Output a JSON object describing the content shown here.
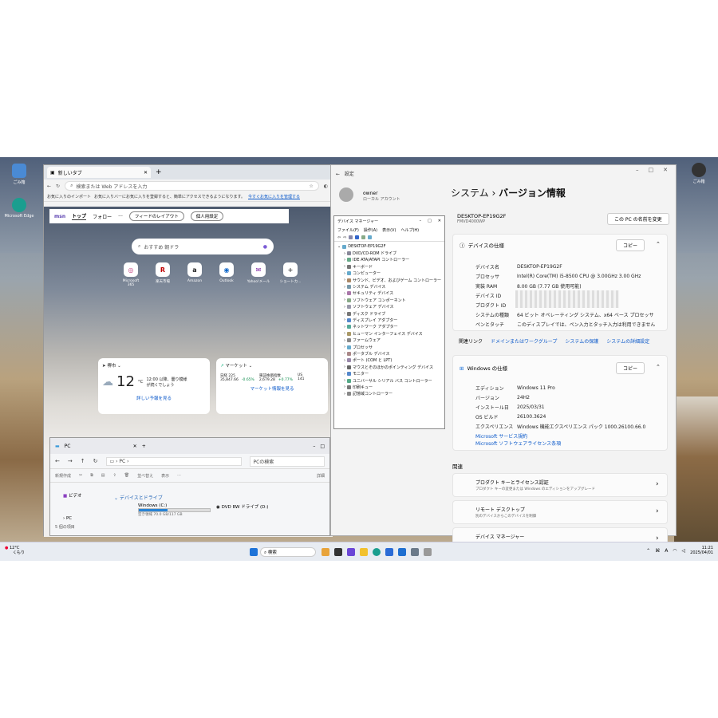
{
  "desktop": {
    "icons": [
      {
        "label": "ごみ箱",
        "color": "#4a8ad4"
      },
      {
        "label": "Microsoft Edge",
        "color": "#1a9e8f"
      }
    ],
    "right_icon": "ごみ箱"
  },
  "edge": {
    "tab_label": "新しいタブ",
    "addr_placeholder": "検索または Web アドレスを入力",
    "fav_import": "お気に入りのインポート",
    "fav_text": "お気に入りバーにお気に入りを登録すると、簡単にアクセスできるようになります。",
    "fav_link": "今すぐお気に入りを管理する",
    "search_text": "おすすめ 朝ドラ",
    "quicklinks": [
      {
        "label": "Microsoft 365",
        "glyph": "◎",
        "color": "#c03b7c"
      },
      {
        "label": "楽天市場",
        "glyph": "R",
        "color": "#bf0000"
      },
      {
        "label": "Amazon",
        "glyph": "a",
        "color": "#222"
      },
      {
        "label": "Outlook",
        "glyph": "◉",
        "color": "#0a64c8"
      },
      {
        "label": "Yahoo!メール",
        "glyph": "✉",
        "color": "#7b1fa2"
      },
      {
        "label": "ショートカ...",
        "glyph": "+",
        "color": "#444"
      }
    ],
    "weather": {
      "location": "堺市",
      "temp": "12",
      "unit": "°C",
      "note": "12:00 以降、曇り模様が続くでしょう",
      "link": "詳しい予報を見る"
    },
    "market": {
      "title": "マーケット",
      "items": [
        {
          "name": "日経 225",
          "value": "35,847.66",
          "change": "-0.65%"
        },
        {
          "name": "東証株価指数",
          "value": "2,679.28",
          "change": "+0.77%"
        },
        {
          "name": "US",
          "value": "141",
          "change": ""
        }
      ],
      "link": "マーケット情報を見る"
    },
    "msn": {
      "brand": "msn",
      "tabs": [
        "トップ",
        "フォロー"
      ],
      "more": "···",
      "layout": "フィードのレイアウト",
      "personal": "個人用設定"
    }
  },
  "explorer": {
    "title": "PC",
    "path": "PC",
    "search": "PCの検索",
    "cmds": [
      "新規作成",
      "並べ替え",
      "表示",
      "···",
      "詳細"
    ],
    "quick": "ビデオ",
    "group": "デバイスとドライブ",
    "drive_c": "Windows (C:)",
    "drive_c_info": "空き領域 70.0 GB/117 GB",
    "drive_c_used": 0.4,
    "drive_d": "DVD RW ドライブ (D:)",
    "tree_pc": "PC",
    "status": "5 個の項目"
  },
  "settings": {
    "app": "設定",
    "user": "owner",
    "user_sub": "ローカル アカウント",
    "breadcrumb_a": "システム",
    "breadcrumb_b": "バージョン情報",
    "pc_name": "DESKTOP-EP19G2F",
    "pc_model": "FMVD4000WP",
    "rename": "この PC の名前を変更",
    "spec_title": "デバイスの仕様",
    "copy": "コピー",
    "spec": [
      {
        "k": "デバイス名",
        "v": "DESKTOP-EP19G2F"
      },
      {
        "k": "プロセッサ",
        "v": "Intel(R) Core(TM) i5-8500 CPU @ 3.00GHz   3.00 GHz"
      },
      {
        "k": "実装 RAM",
        "v": "8.00 GB (7.77 GB 使用可能)"
      },
      {
        "k": "デバイス ID",
        "v": ""
      },
      {
        "k": "プロダクト ID",
        "v": ""
      },
      {
        "k": "システムの種類",
        "v": "64 ビット オペレーティング システム、x64 ベース プロセッサ"
      },
      {
        "k": "ペンとタッチ",
        "v": "このディスプレイでは、ペン入力とタッチ入力は利用できません"
      }
    ],
    "related_label": "関連リンク",
    "related": [
      "ドメインまたはワークグループ",
      "システムの保護",
      "システムの詳細設定"
    ],
    "win_title": "Windows の仕様",
    "win": [
      {
        "k": "エディション",
        "v": "Windows 11 Pro"
      },
      {
        "k": "バージョン",
        "v": "24H2"
      },
      {
        "k": "インストール日",
        "v": "2025/03/31"
      },
      {
        "k": "OS ビルド",
        "v": "26100.3624"
      },
      {
        "k": "エクスペリエンス",
        "v": "Windows 機能エクスペリエンス パック 1000.26100.66.0"
      }
    ],
    "links": [
      "Microsoft サービス規約",
      "Microsoft ソフトウェアライセンス条項"
    ],
    "kanren": "関連",
    "items": [
      {
        "t": "プロダクト キーとライセンス認証",
        "s": "プロダクト キーの変更または Windows のエディションをアップグレード"
      },
      {
        "t": "リモート デスクトップ",
        "s": "別のデバイスからこのデバイスを制御"
      },
      {
        "t": "デバイス マネージャー",
        "s": ""
      }
    ]
  },
  "devmgr": {
    "title": "デバイス マネージャー",
    "menu": [
      "ファイル(F)",
      "操作(A)",
      "表示(V)",
      "ヘルプ(H)"
    ],
    "root": "DESKTOP-EP19G2F",
    "nodes": [
      "DVD/CD-ROM ドライブ",
      "IDE ATA/ATAPI コントローラー",
      "キーボード",
      "コンピューター",
      "サウンド、ビデオ、およびゲーム コントローラー",
      "システム デバイス",
      "セキュリティ デバイス",
      "ソフトウェア コンポーネント",
      "ソフトウェア デバイス",
      "ディスク ドライブ",
      "ディスプレイ アダプター",
      "ネットワーク アダプター",
      "ヒューマン インターフェイス デバイス",
      "ファームウェア",
      "プロセッサ",
      "ポータブル デバイス",
      "ポート (COM と LPT)",
      "マウスとそのほかのポインティング デバイス",
      "モニター",
      "ユニバーサル シリアル バス コントローラー",
      "印刷キュー",
      "記憶域コントローラー"
    ]
  },
  "taskbar": {
    "weather_temp": "12°C",
    "weather_note": "くもり",
    "search": "検索",
    "time": "11:21",
    "date": "2025/04/01",
    "ime": "A"
  }
}
